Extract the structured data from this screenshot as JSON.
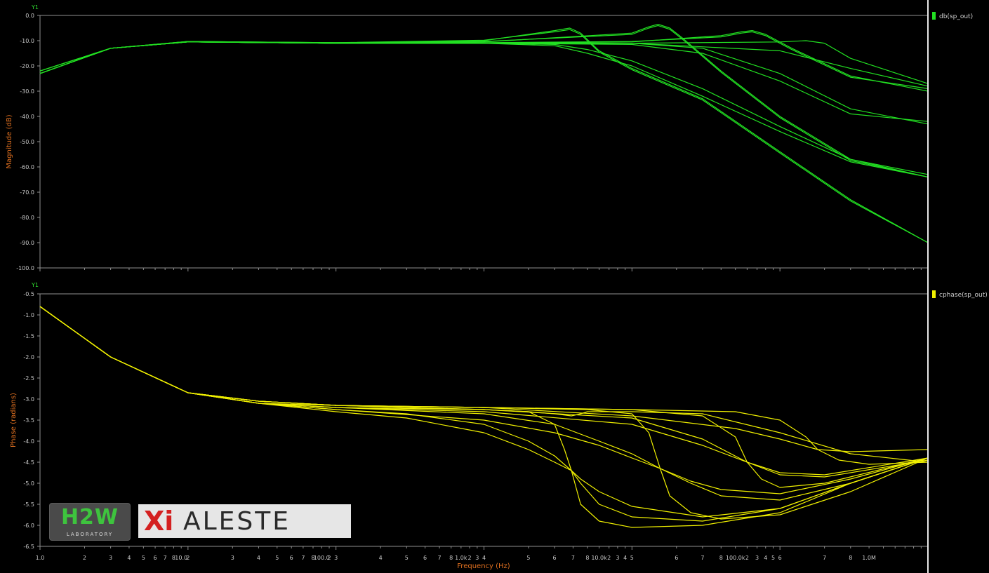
{
  "chart_data": [
    {
      "type": "line",
      "axis_tag": "Y1",
      "ylabel": "Magnitude (dB)",
      "yticks": [
        "0.0",
        "-10.0",
        "-20.0",
        "-30.0",
        "-40.0",
        "-50.0",
        "-60.0",
        "-70.0",
        "-80.0",
        "-90.0",
        "-100.0"
      ],
      "ylim": [
        -100,
        0
      ],
      "xlim": [
        1,
        1000000
      ],
      "xscale": "log",
      "legend": "db(sp_out)",
      "color": "#22e022",
      "series": [
        {
          "x": [
            1,
            3,
            10,
            100,
            1000,
            3000,
            3800,
            4500,
            6000,
            10000,
            30000,
            100000,
            300000,
            1000000
          ],
          "y": [
            -23,
            -13,
            -10.5,
            -11,
            -10,
            -6,
            -5,
            -7,
            -14,
            -21,
            -33,
            -54,
            -73,
            -90
          ]
        },
        {
          "x": [
            1,
            3,
            10,
            100,
            1000,
            3000,
            3800,
            4500,
            6000,
            10000,
            30000,
            100000,
            300000,
            1000000
          ],
          "y": [
            -22,
            -13,
            -10.3,
            -10.8,
            -9.8,
            -6.5,
            -5.6,
            -7.5,
            -14.5,
            -21.5,
            -33.5,
            -54.5,
            -73.5,
            -90
          ]
        },
        {
          "x": [
            1,
            3,
            10,
            100,
            1000,
            3000,
            5000,
            10000,
            30000,
            100000,
            300000,
            1000000
          ],
          "y": [
            -23,
            -13,
            -10.5,
            -11,
            -11,
            -12,
            -15,
            -20,
            -32,
            -46,
            -58,
            -64
          ]
        },
        {
          "x": [
            1,
            3,
            10,
            100,
            1000,
            3000,
            5000,
            10000,
            30000,
            100000,
            300000,
            1000000
          ],
          "y": [
            -23,
            -13,
            -10.5,
            -11,
            -11,
            -11.5,
            -13.5,
            -18,
            -29,
            -44,
            -57,
            -63
          ]
        },
        {
          "x": [
            1,
            3,
            10,
            100,
            1000,
            10000,
            13000,
            15000,
            18000,
            22000,
            40000,
            100000,
            300000,
            1000000
          ],
          "y": [
            -23,
            -13,
            -10.5,
            -11,
            -10.5,
            -7,
            -4.5,
            -3.5,
            -5,
            -9,
            -22,
            -40,
            -57,
            -64
          ]
        },
        {
          "x": [
            1,
            3,
            10,
            100,
            1000,
            10000,
            13000,
            15000,
            18000,
            22000,
            40000,
            100000,
            300000,
            1000000
          ],
          "y": [
            -22,
            -13,
            -10.3,
            -10.8,
            -10.3,
            -7.5,
            -5,
            -4,
            -5.5,
            -9.5,
            -22.5,
            -40.5,
            -57.5,
            -64
          ]
        },
        {
          "x": [
            1,
            3,
            10,
            100,
            1000,
            10000,
            30000,
            100000,
            300000,
            1000000
          ],
          "y": [
            -23,
            -13,
            -10.5,
            -11,
            -11,
            -11.5,
            -15,
            -26,
            -39,
            -42
          ]
        },
        {
          "x": [
            1,
            3,
            10,
            100,
            1000,
            10000,
            30000,
            100000,
            300000,
            1000000
          ],
          "y": [
            -23,
            -13,
            -10.5,
            -11,
            -11,
            -11,
            -13,
            -23,
            -37,
            -43
          ]
        },
        {
          "x": [
            1,
            3,
            10,
            100,
            1000,
            10000,
            40000,
            55000,
            65000,
            80000,
            120000,
            300000,
            1000000
          ],
          "y": [
            -23,
            -13,
            -10.5,
            -11,
            -11,
            -10.5,
            -8,
            -6.5,
            -6,
            -7.5,
            -13,
            -24,
            -30
          ]
        },
        {
          "x": [
            1,
            3,
            10,
            100,
            1000,
            10000,
            40000,
            55000,
            65000,
            80000,
            120000,
            300000,
            1000000
          ],
          "y": [
            -22,
            -13,
            -10.3,
            -10.8,
            -10.8,
            -10.3,
            -8.5,
            -7,
            -6.5,
            -8,
            -13.5,
            -24.5,
            -29
          ]
        },
        {
          "x": [
            1,
            3,
            10,
            100,
            1000,
            10000,
            100000,
            300000,
            1000000
          ],
          "y": [
            -23,
            -13,
            -10.5,
            -11,
            -11,
            -11,
            -14,
            -21,
            -28
          ]
        },
        {
          "x": [
            1,
            3,
            10,
            100,
            1000,
            10000,
            100000,
            150000,
            200000,
            300000,
            1000000
          ],
          "y": [
            -23,
            -13,
            -10.5,
            -11,
            -11,
            -11,
            -10.5,
            -10,
            -11,
            -17,
            -27
          ]
        }
      ]
    },
    {
      "type": "line",
      "axis_tag": "Y1",
      "ylabel": "Phase (radians)",
      "xlabel": "Frequency (Hz)",
      "yticks": [
        "-0.5",
        "-1.0",
        "-1.5",
        "-2.0",
        "-2.5",
        "-3.0",
        "-3.5",
        "-4.0",
        "-4.5",
        "-5.0",
        "-5.5",
        "-6.0",
        "-6.5"
      ],
      "ylim": [
        -6.5,
        -0.5
      ],
      "xlim": [
        1,
        1000000
      ],
      "xscale": "log",
      "xticks": [
        "1.0",
        "2",
        "3",
        "4",
        "5",
        "6",
        "7",
        "8",
        "10.0",
        "2",
        "3",
        "4",
        "5",
        "6",
        "7",
        "8",
        "100.0",
        "2",
        "3",
        "4",
        "5",
        "6",
        "7",
        "8",
        "1.0k",
        "2",
        "3",
        "4",
        "5",
        "6",
        "7",
        "8",
        "10.0k",
        "2",
        "3",
        "4",
        "5",
        "6",
        "7",
        "8",
        "100.0k",
        "2",
        "3",
        "4",
        "5",
        "6",
        "7",
        "8",
        "1.0M"
      ],
      "legend": "cphase(sp_out)",
      "color": "#f0f000",
      "series": [
        {
          "x": [
            1,
            3,
            10,
            30,
            100,
            300,
            1000,
            2000,
            3000,
            3500,
            3900,
            4500,
            6000,
            10000,
            30000,
            100000,
            300000,
            1000000
          ],
          "y": [
            -0.8,
            -2.0,
            -2.85,
            -3.05,
            -3.15,
            -3.2,
            -3.25,
            -3.3,
            -3.6,
            -4.2,
            -4.7,
            -5.5,
            -5.9,
            -6.05,
            -6.0,
            -5.7,
            -5.0,
            -4.4
          ]
        },
        {
          "x": [
            1,
            3,
            10,
            30,
            100,
            300,
            1000,
            2000,
            3000,
            3900,
            4500,
            6000,
            10000,
            30000,
            100000,
            300000,
            1000000
          ],
          "y": [
            -0.8,
            -2.0,
            -2.85,
            -3.1,
            -3.3,
            -3.45,
            -3.8,
            -4.2,
            -4.5,
            -4.7,
            -5.0,
            -5.5,
            -5.8,
            -5.9,
            -5.6,
            -5.0,
            -4.4
          ]
        },
        {
          "x": [
            1,
            3,
            10,
            30,
            100,
            300,
            1000,
            2000,
            3000,
            3900,
            4500,
            6000,
            10000,
            30000,
            100000,
            300000,
            1000000
          ],
          "y": [
            -0.8,
            -2.0,
            -2.85,
            -3.1,
            -3.25,
            -3.35,
            -3.6,
            -4.0,
            -4.35,
            -4.7,
            -4.9,
            -5.2,
            -5.55,
            -5.8,
            -5.6,
            -5.0,
            -4.4
          ]
        },
        {
          "x": [
            1,
            3,
            10,
            30,
            100,
            300,
            1000,
            2000,
            3000,
            3900,
            4500,
            5000,
            6000,
            10000,
            30000,
            100000,
            300000,
            1000000
          ],
          "y": [
            -0.8,
            -2.0,
            -2.85,
            -3.1,
            -3.15,
            -3.2,
            -3.25,
            -3.3,
            -3.35,
            -3.4,
            -3.35,
            -3.3,
            -3.3,
            -3.3,
            -3.35,
            -3.8,
            -4.3,
            -4.5
          ]
        },
        {
          "x": [
            1,
            3,
            10,
            30,
            100,
            1000,
            5000,
            10000,
            13000,
            15500,
            18000,
            25000,
            40000,
            100000,
            300000,
            1000000
          ],
          "y": [
            -0.8,
            -2.0,
            -2.85,
            -3.05,
            -3.15,
            -3.2,
            -3.25,
            -3.35,
            -3.8,
            -4.65,
            -5.3,
            -5.7,
            -5.85,
            -5.75,
            -5.2,
            -4.4
          ]
        },
        {
          "x": [
            1,
            3,
            10,
            30,
            100,
            1000,
            3000,
            6000,
            10000,
            15500,
            25000,
            40000,
            100000,
            300000,
            1000000
          ],
          "y": [
            -0.8,
            -2.0,
            -2.85,
            -3.1,
            -3.25,
            -3.5,
            -3.8,
            -4.1,
            -4.4,
            -4.65,
            -5.0,
            -5.3,
            -5.4,
            -5.0,
            -4.4
          ]
        },
        {
          "x": [
            1,
            3,
            10,
            30,
            100,
            1000,
            3000,
            6000,
            10000,
            15500,
            25000,
            40000,
            100000,
            300000,
            1000000
          ],
          "y": [
            -0.8,
            -2.0,
            -2.85,
            -3.1,
            -3.2,
            -3.35,
            -3.6,
            -4.0,
            -4.3,
            -4.65,
            -4.95,
            -5.15,
            -5.25,
            -4.9,
            -4.4
          ]
        },
        {
          "x": [
            1,
            3,
            10,
            30,
            100,
            1000,
            10000,
            30000,
            50000,
            60000,
            75000,
            100000,
            200000,
            1000000
          ],
          "y": [
            -0.8,
            -2.0,
            -2.85,
            -3.05,
            -3.15,
            -3.2,
            -3.25,
            -3.4,
            -3.9,
            -4.5,
            -4.9,
            -5.1,
            -5.0,
            -4.4
          ]
        },
        {
          "x": [
            1,
            3,
            10,
            30,
            100,
            1000,
            10000,
            30000,
            60000,
            100000,
            200000,
            1000000
          ],
          "y": [
            -0.8,
            -2.0,
            -2.85,
            -3.1,
            -3.2,
            -3.3,
            -3.6,
            -4.1,
            -4.5,
            -4.75,
            -4.8,
            -4.4
          ]
        },
        {
          "x": [
            1,
            3,
            10,
            30,
            100,
            1000,
            10000,
            30000,
            60000,
            100000,
            200000,
            1000000
          ],
          "y": [
            -0.8,
            -2.0,
            -2.85,
            -3.1,
            -3.2,
            -3.25,
            -3.45,
            -3.95,
            -4.5,
            -4.8,
            -4.85,
            -4.45
          ]
        },
        {
          "x": [
            1,
            3,
            10,
            30,
            100,
            1000,
            10000,
            50000,
            100000,
            150000,
            180000,
            250000,
            400000,
            1000000
          ],
          "y": [
            -0.8,
            -2.0,
            -2.85,
            -3.05,
            -3.15,
            -3.2,
            -3.25,
            -3.3,
            -3.5,
            -3.9,
            -4.2,
            -4.45,
            -4.55,
            -4.5
          ]
        },
        {
          "x": [
            1,
            3,
            10,
            30,
            100,
            1000,
            10000,
            50000,
            100000,
            180000,
            300000,
            1000000
          ],
          "y": [
            -0.8,
            -2.0,
            -2.85,
            -3.05,
            -3.15,
            -3.2,
            -3.4,
            -3.7,
            -3.95,
            -4.2,
            -4.25,
            -4.2
          ]
        }
      ]
    }
  ],
  "logos": {
    "h2w_main": "H2W",
    "h2w_sub": "LABORATORY",
    "xi": "Xi",
    "aleste": "ALESTE"
  }
}
